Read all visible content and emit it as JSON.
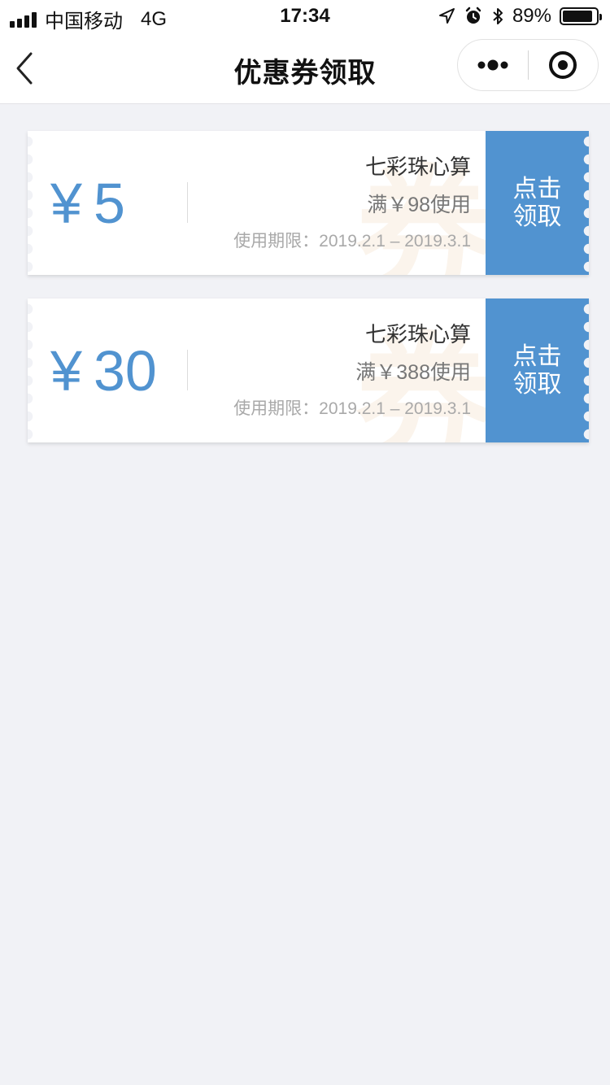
{
  "status_bar": {
    "carrier": "中国移动",
    "network": "4G",
    "time": "17:34",
    "battery": "89%",
    "battery_level": 0.89
  },
  "nav": {
    "title": "优惠券领取",
    "icons": {
      "back": "chevron-left-icon",
      "more": "more-dots-icon",
      "close": "target-close-icon"
    }
  },
  "coupons": [
    {
      "currency": "¥",
      "amount": "5",
      "shop": "七彩珠心算",
      "condition": "满￥98使用",
      "validity": "使用期限：2019.2.1 – 2019.3.1",
      "claim_label": "点击领取",
      "watermark": "券"
    },
    {
      "currency": "¥",
      "amount": "30",
      "shop": "七彩珠心算",
      "condition": "满￥388使用",
      "validity": "使用期限：2019.2.1 – 2019.3.1",
      "claim_label": "点击领取",
      "watermark": "券"
    }
  ],
  "colors": {
    "accent": "#5193d0",
    "background": "#f1f2f6",
    "watermark": "#fbf4ec"
  }
}
